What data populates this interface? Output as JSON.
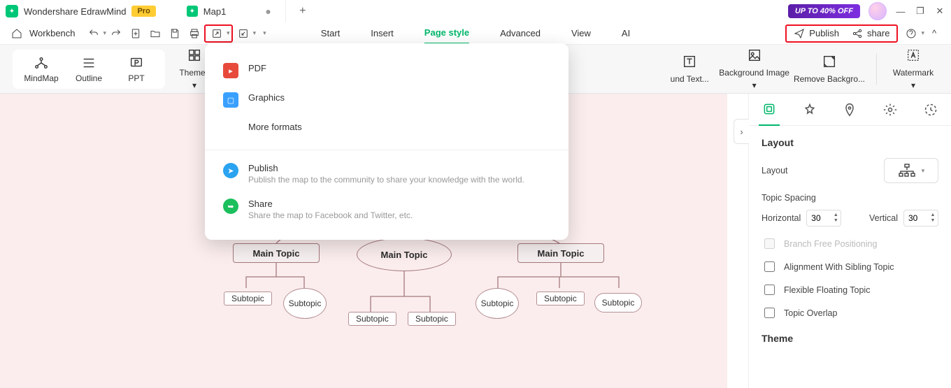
{
  "app": {
    "name": "Wondershare EdrawMind",
    "badge": "Pro",
    "promo": "UP TO 40% OFF"
  },
  "tab": {
    "name": "Map1"
  },
  "toolbar": {
    "workbench": "Workbench"
  },
  "mainTabs": {
    "start": "Start",
    "insert": "Insert",
    "pageStyle": "Page style",
    "advanced": "Advanced",
    "view": "View",
    "ai": "AI"
  },
  "pubshare": {
    "publish": "Publish",
    "share": "share"
  },
  "ribbon": {
    "mindmap": "MindMap",
    "outline": "Outline",
    "ppt": "PPT",
    "themes": "Themes",
    "bgtext": "und Text...",
    "bgimg": "Background Image",
    "removebg": "Remove Backgro...",
    "watermark": "Watermark"
  },
  "export": {
    "pdf": "PDF",
    "graphics": "Graphics",
    "more": "More formats",
    "publish": "Publish",
    "publish_sub": "Publish the map to the community to share your knowledge with the world.",
    "share": "Share",
    "share_sub": "Share the map to Facebook and Twitter, etc."
  },
  "mindmap": {
    "main": "Main Topic",
    "sub": "Subtopic"
  },
  "panel": {
    "layout": "Layout",
    "layout_label": "Layout",
    "spacing": "Topic Spacing",
    "horizontal": "Horizontal",
    "vertical": "Vertical",
    "h_val": "30",
    "v_val": "30",
    "branch": "Branch Free Positioning",
    "align": "Alignment With Sibling Topic",
    "float": "Flexible Floating Topic",
    "overlap": "Topic Overlap",
    "theme": "Theme"
  }
}
